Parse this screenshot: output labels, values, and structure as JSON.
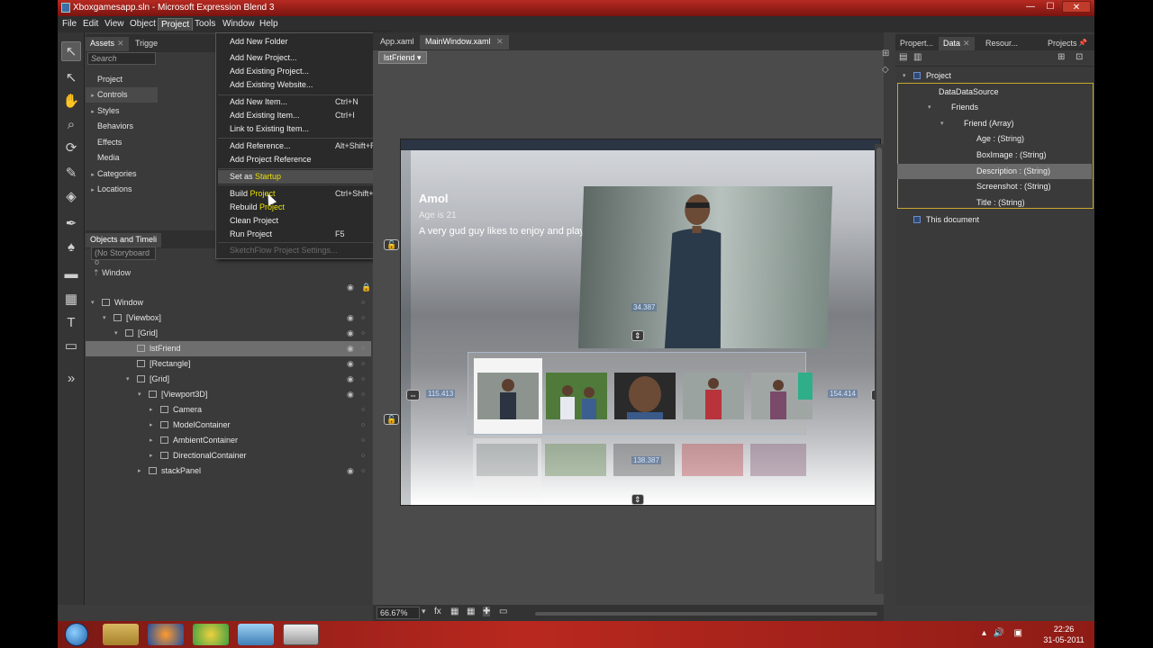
{
  "window": {
    "title": "Xboxgamesapp.sln - Microsoft Expression Blend 3",
    "min": "—",
    "max": "☐",
    "close": "✕"
  },
  "menubar": [
    "File",
    "Edit",
    "View",
    "Object",
    "Project",
    "Tools",
    "Window",
    "Help"
  ],
  "project_menu": {
    "items": [
      {
        "label": "Add New Folder"
      },
      {
        "label": "Add New Project..."
      },
      {
        "label": "Add Existing Project..."
      },
      {
        "label": "Add Existing Website..."
      },
      {
        "label": "Add New Item...",
        "shortcut": "Ctrl+N"
      },
      {
        "label": "Add Existing Item...",
        "shortcut": "Ctrl+I"
      },
      {
        "label": "Link to Existing Item..."
      },
      {
        "label": "Add Reference...",
        "shortcut": "Alt+Shift+R"
      },
      {
        "label": "Add Project Reference",
        "submenu": "▸"
      },
      {
        "label_a": "Set as ",
        "label_b": "Startup",
        "submenu": "▸"
      },
      {
        "label_a": "Build ",
        "label_b": "Project",
        "shortcut": "Ctrl+Shift+B"
      },
      {
        "label_a": "Rebuild ",
        "label_b": "Project"
      },
      {
        "label": "Clean Project"
      },
      {
        "label": "Run Project",
        "shortcut": "F5"
      },
      {
        "label": "SketchFlow Project Settings..."
      }
    ]
  },
  "left_tabs": {
    "assets": "Assets",
    "triggers": "Trigge",
    "search_placeholder": "Search",
    "assets_list": [
      {
        "label": "Project",
        "arrow": ""
      },
      {
        "label": "Controls",
        "arrow": "▸"
      },
      {
        "label": "Styles",
        "arrow": "▸"
      },
      {
        "label": "Behaviors",
        "arrow": ""
      },
      {
        "label": "Effects",
        "arrow": ""
      },
      {
        "label": "Media",
        "arrow": ""
      },
      {
        "label": "Categories",
        "arrow": "▸"
      },
      {
        "label": "Locations",
        "arrow": "▸"
      }
    ]
  },
  "objects_panel": {
    "title": "Objects and Timeli",
    "storyboard": "(No Storyboard o",
    "scope": "Window",
    "tree": [
      {
        "label": "Window",
        "level": 0,
        "arrow": "▾",
        "eye": ""
      },
      {
        "label": "[Viewbox]",
        "level": 1,
        "arrow": "▾",
        "eye": "◉"
      },
      {
        "label": "[Grid]",
        "level": 2,
        "arrow": "▾",
        "eye": "◉"
      },
      {
        "label": "lstFriend",
        "level": 3,
        "arrow": "",
        "eye": "◉",
        "selected": true
      },
      {
        "label": "[Rectangle]",
        "level": 3,
        "arrow": "",
        "eye": "◉"
      },
      {
        "label": "[Grid]",
        "level": 3,
        "arrow": "▾",
        "eye": "◉"
      },
      {
        "label": "[Viewport3D]",
        "level": 4,
        "arrow": "▾",
        "eye": "◉"
      },
      {
        "label": "Camera",
        "level": 5,
        "arrow": "▸",
        "eye": ""
      },
      {
        "label": "ModelContainer",
        "level": 5,
        "arrow": "▸",
        "eye": ""
      },
      {
        "label": "AmbientContainer",
        "level": 5,
        "arrow": "▸",
        "eye": ""
      },
      {
        "label": "DirectionalContainer",
        "level": 5,
        "arrow": "▸",
        "eye": ""
      },
      {
        "label": "stackPanel",
        "level": 4,
        "arrow": "▸",
        "eye": "◉"
      }
    ]
  },
  "documents": {
    "tabs": [
      "App.xaml",
      "MainWindow.xaml"
    ],
    "close": "✕",
    "breadcrumb": "lstFriend ▾"
  },
  "artboard": {
    "name": "Amol",
    "age": "Age is 21",
    "description": "A very gud guy likes to enjoy and play cricket",
    "dim_left": "115.413",
    "dim_right": "154.414",
    "dim_top": "34.387",
    "dim_bottom": "138.387"
  },
  "statusbar": {
    "zoom": "66.67%"
  },
  "right_panel": {
    "tabs": [
      "Propert...",
      "Data",
      "Resour...",
      "Projects"
    ],
    "tree": [
      {
        "label": "Project",
        "level": 0,
        "arrow": "▾"
      },
      {
        "label": "DataDataSource",
        "level": 1,
        "arrow": ""
      },
      {
        "label": "Friends",
        "level": 2,
        "arrow": "▾"
      },
      {
        "label": "Friend (Array)",
        "level": 3,
        "arrow": "▾"
      },
      {
        "label": "Age : (String)",
        "level": 4,
        "arrow": ""
      },
      {
        "label": "BoxImage : (String)",
        "level": 4,
        "arrow": ""
      },
      {
        "label": "Description : (String)",
        "level": 4,
        "arrow": "",
        "selected": true
      },
      {
        "label": "Screenshot : (String)",
        "level": 4,
        "arrow": ""
      },
      {
        "label": "Title : (String)",
        "level": 4,
        "arrow": ""
      },
      {
        "label": "This document",
        "level": 0,
        "arrow": ""
      }
    ]
  },
  "taskbar": {
    "time": "22:26",
    "date": "31-05-2011"
  },
  "colors": {
    "title_red": "#b62a22",
    "highlight_yellow": "#e8e000",
    "data_border": "#c8a62e"
  }
}
